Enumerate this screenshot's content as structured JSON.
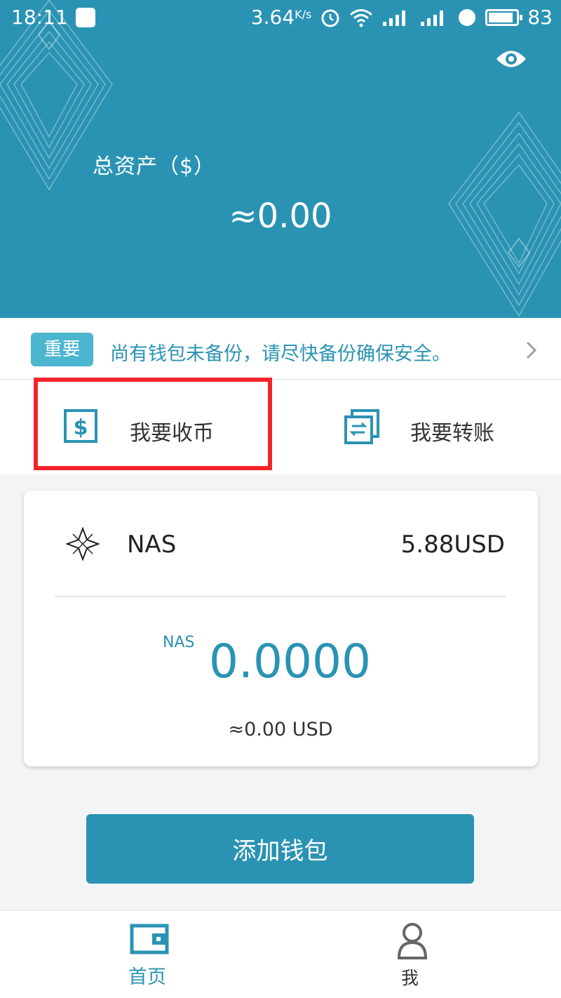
{
  "status_bar": {
    "time": "18:11",
    "speed_value": "3.64",
    "speed_unit": "K/s",
    "battery": "83"
  },
  "header": {
    "total_assets_label": "总资产（$）",
    "total_assets_value": "≈0.00",
    "eye_icon": "eye-icon"
  },
  "notice": {
    "badge": "重要",
    "text": "尚有钱包未备份，请尽快备份确保安全。"
  },
  "actions": {
    "receive_label": "我要收币",
    "transfer_label": "我要转账"
  },
  "wallet_card": {
    "coin_name": "NAS",
    "coin_price": "5.88USD",
    "balance_unit": "NAS",
    "balance_amount": "0.0000",
    "balance_usd": "≈0.00 USD"
  },
  "add_wallet_label": "添加钱包",
  "bottom_nav": {
    "home_label": "首页",
    "me_label": "我"
  },
  "colors": {
    "primary": "#2a93b3",
    "badge": "#4cb5cf",
    "highlight": "#f2232a"
  }
}
